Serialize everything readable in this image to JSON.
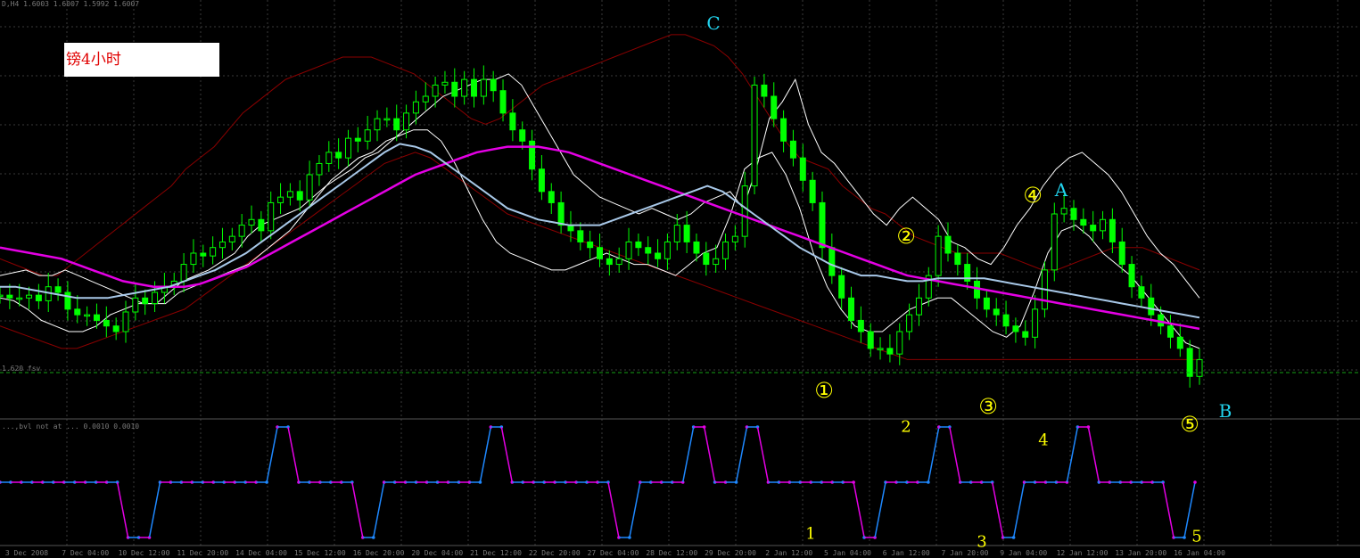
{
  "title": "镑4小时",
  "header": {
    "main": "D,H4  1.6003 1.6007 1.5992 1.6007",
    "indicator": "...,bvl not at ...  0.0010 0.0010",
    "level_label": "1.620 fsv"
  },
  "colors": {
    "background": "#000000",
    "grid": "#3a3a3a",
    "candle": "#00ff00",
    "ma_slow": "#e400e4",
    "ma_mid": "#a8c8e8",
    "envelope": "#ffffff",
    "bollinger": "#8a0000",
    "level": "#16a016",
    "ind_up": "#1e88ff",
    "ind_down": "#e400e4",
    "wave_label": "#ffff00",
    "abc_label": "#22d3ee"
  },
  "chart_data": {
    "type": "line",
    "instrument_caption": "镑4小时",
    "x_tick_labels": [
      "3 Dec 2008",
      "7 Dec 04:00",
      "10 Dec 12:00",
      "11 Dec 20:00",
      "14 Dec 04:00",
      "15 Dec 12:00",
      "16 Dec 20:00",
      "20 Dec 04:00",
      "21 Dec 12:00",
      "22 Dec 20:00",
      "27 Dec 04:00",
      "28 Dec 12:00",
      "29 Dec 20:00",
      "2 Jan 12:00",
      "5 Jan 04:00",
      "6 Jan 12:00",
      "7 Jan 20:00",
      "9 Jan 04:00",
      "12 Jan 12:00",
      "13 Jan 20:00",
      "16 Jan 04:00"
    ],
    "ohlc_price_series": [
      41,
      40,
      40,
      41,
      39,
      44,
      42,
      36,
      34,
      34,
      32,
      30,
      28,
      35,
      40,
      38,
      42,
      44,
      46,
      52,
      56,
      55,
      58,
      60,
      62,
      66,
      68,
      64,
      74,
      76,
      78,
      75,
      84,
      88,
      92,
      90,
      97,
      96,
      100,
      104,
      104,
      100,
      106,
      110,
      112,
      116,
      117,
      112,
      118,
      112,
      118,
      114,
      106,
      100,
      96,
      86,
      78,
      74,
      66,
      64,
      60,
      58,
      54,
      52,
      54,
      60,
      58,
      56,
      54,
      60,
      66,
      60,
      56,
      52,
      54,
      60,
      62,
      80,
      116,
      112,
      104,
      96,
      90,
      82,
      74,
      58,
      48,
      40,
      32,
      28,
      22,
      22,
      20,
      28,
      34,
      40,
      48,
      62,
      56,
      52,
      46,
      40,
      36,
      34,
      30,
      28,
      26,
      36,
      50,
      70,
      72,
      68,
      66,
      64,
      68,
      60,
      52,
      44,
      40,
      34,
      30,
      26,
      22,
      12,
      18
    ],
    "series": [
      {
        "name": "",
        "color": "#ffffff",
        "role": "upper envelope",
        "values": [
          48,
          49,
          50,
          48,
          48,
          50,
          48,
          46,
          44,
          42,
          40,
          38,
          38,
          42,
          46,
          48,
          50,
          53,
          56,
          62,
          66,
          68,
          70,
          72,
          76,
          80,
          83,
          86,
          90,
          92,
          96,
          100,
          104,
          108,
          112,
          114,
          116,
          118,
          118,
          120,
          116,
          108,
          100,
          92,
          84,
          80,
          76,
          74,
          72,
          70,
          72,
          70,
          68,
          70,
          74,
          76,
          78,
          72,
          86,
          104,
          110,
          118,
          102,
          92,
          88,
          82,
          76,
          70,
          66,
          72,
          76,
          72,
          68,
          60,
          58,
          54,
          52,
          58,
          66,
          72,
          80,
          86,
          90,
          92,
          88,
          84,
          78,
          70,
          62,
          56,
          52,
          46,
          40
        ]
      },
      {
        "name": "",
        "color": "#ffffff",
        "role": "lower envelope",
        "values": [
          40,
          39,
          36,
          32,
          30,
          28,
          28,
          30,
          34,
          36,
          38,
          38,
          38,
          42,
          44,
          46,
          48,
          50,
          52,
          56,
          60,
          64,
          70,
          76,
          82,
          86,
          90,
          92,
          96,
          98,
          100,
          100,
          96,
          88,
          78,
          68,
          60,
          56,
          54,
          52,
          50,
          50,
          52,
          54,
          56,
          54,
          52,
          52,
          50,
          48,
          52,
          56,
          58,
          70,
          86,
          90,
          92,
          84,
          72,
          56,
          44,
          36,
          30,
          28,
          28,
          32,
          36,
          38,
          40,
          40,
          36,
          32,
          28,
          26,
          30,
          42,
          56,
          64,
          66,
          62,
          56,
          52,
          48,
          42,
          36,
          30,
          24,
          22
        ]
      },
      {
        "name": "",
        "color": "#a8c8e8",
        "role": "mid average",
        "values": [
          44,
          44,
          43,
          42,
          41,
          40,
          40,
          40,
          41,
          42,
          43,
          44,
          46,
          48,
          50,
          53,
          56,
          60,
          64,
          68,
          72,
          76,
          80,
          84,
          88,
          92,
          95,
          94,
          92,
          88,
          84,
          80,
          76,
          72,
          70,
          68,
          67,
          66,
          66,
          66,
          68,
          70,
          72,
          74,
          76,
          78,
          80,
          78,
          74,
          70,
          66,
          62,
          58,
          55,
          52,
          50,
          48,
          48,
          47,
          46,
          46,
          47,
          47,
          47,
          47,
          46,
          45,
          44,
          43,
          42,
          41,
          40,
          39,
          38,
          37,
          36,
          35,
          34,
          33
        ]
      },
      {
        "name": "",
        "color": "#e400e4",
        "role": "slow average",
        "values": [
          58,
          57,
          56,
          55,
          54,
          52,
          50,
          48,
          46,
          45,
          44,
          44,
          44,
          45,
          47,
          49,
          51,
          54,
          57,
          60,
          63,
          66,
          69,
          72,
          75,
          78,
          81,
          84,
          86,
          88,
          90,
          92,
          93,
          94,
          94,
          94,
          93,
          92,
          90,
          88,
          86,
          84,
          82,
          80,
          78,
          76,
          74,
          72,
          70,
          68,
          66,
          64,
          62,
          60,
          58,
          56,
          54,
          52,
          50,
          48,
          47,
          46,
          45,
          44,
          43,
          42,
          41,
          40,
          39,
          38,
          37,
          36,
          35,
          34,
          33,
          32,
          31,
          30,
          29
        ]
      },
      {
        "name": "",
        "color": "#8a0000",
        "role": "bollinger upper",
        "values": [
          54,
          52,
          50,
          48,
          48,
          52,
          56,
          60,
          64,
          68,
          72,
          76,
          80,
          86,
          90,
          94,
          100,
          106,
          110,
          114,
          118,
          120,
          122,
          124,
          126,
          126,
          126,
          124,
          122,
          120,
          116,
          112,
          108,
          104,
          102,
          104,
          108,
          112,
          116,
          118,
          120,
          122,
          124,
          126,
          128,
          130,
          132,
          134,
          134,
          132,
          130,
          126,
          120,
          112,
          104,
          96,
          90,
          88,
          86,
          80,
          76,
          72,
          70,
          66,
          62,
          60,
          58,
          56,
          56,
          56,
          56,
          54,
          52,
          50,
          50,
          52,
          54,
          56,
          58,
          58,
          58,
          56,
          54,
          52,
          50
        ]
      },
      {
        "name": "",
        "color": "#8a0000",
        "role": "bollinger lower",
        "values": [
          30,
          28,
          26,
          24,
          22,
          22,
          24,
          26,
          28,
          30,
          32,
          34,
          36,
          40,
          44,
          48,
          52,
          56,
          60,
          64,
          68,
          72,
          76,
          80,
          84,
          88,
          90,
          92,
          90,
          86,
          82,
          78,
          74,
          70,
          68,
          66,
          64,
          62,
          60,
          58,
          56,
          54,
          52,
          50,
          48,
          46,
          44,
          42,
          40,
          38,
          36,
          34,
          32,
          30,
          28,
          26,
          24,
          22,
          20,
          18,
          18,
          18,
          18,
          18,
          18,
          18,
          18,
          18,
          18,
          18,
          18,
          18,
          18,
          18,
          18,
          18,
          18,
          18,
          18
        ]
      },
      {
        "name": "",
        "color": "#1e88ff",
        "role": "lower indicator",
        "values": [
          0,
          0,
          0,
          0,
          0,
          0,
          0,
          0,
          0,
          0,
          0,
          0,
          -1,
          -1,
          -1,
          0,
          0,
          0,
          0,
          0,
          0,
          0,
          0,
          0,
          0,
          0,
          1,
          1,
          0,
          0,
          0,
          0,
          0,
          0,
          -1,
          -1,
          0,
          0,
          0,
          0,
          0,
          0,
          0,
          0,
          0,
          0,
          1,
          1,
          0,
          0,
          0,
          0,
          0,
          0,
          0,
          0,
          0,
          0,
          -1,
          -1,
          0,
          0,
          0,
          0,
          0,
          1,
          1,
          0,
          0,
          0,
          1,
          1,
          0,
          0,
          0,
          0,
          0,
          0,
          0,
          0,
          0,
          -1,
          -1,
          0,
          0,
          0,
          0,
          0,
          1,
          1,
          0,
          0,
          0,
          0,
          -1,
          -1,
          0,
          0,
          0,
          0,
          0,
          1,
          1,
          0,
          0,
          0,
          0,
          0,
          0,
          0,
          -1,
          -1,
          0
        ]
      }
    ],
    "wave_labels": [
      "1",
      "2",
      "3",
      "4",
      "5"
    ],
    "wave_labels_circled": [
      "①",
      "②",
      "③",
      "④",
      "⑤"
    ],
    "abc_labels": [
      "C",
      "A",
      "B"
    ],
    "indicator_labels": [
      "1",
      "2",
      "3",
      "4",
      "5"
    ],
    "grid": true
  }
}
